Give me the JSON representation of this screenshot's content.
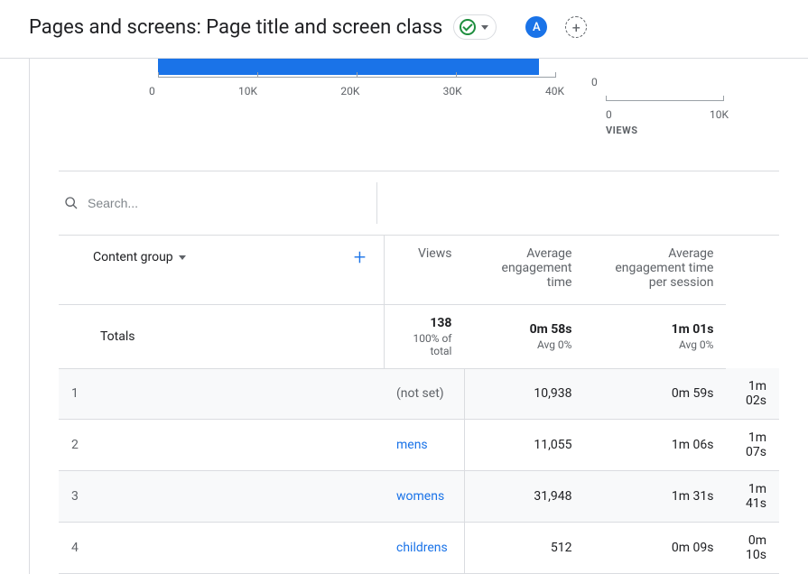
{
  "header": {
    "title": "Pages and screens: Page title and screen class",
    "avatar_letter": "A"
  },
  "chart_data": {
    "type": "bar",
    "main_axis_ticks": [
      "0",
      "10K",
      "20K",
      "30K",
      "40K"
    ],
    "side": {
      "zero_label": "0",
      "ticks": [
        "0",
        "10K"
      ],
      "label": "VIEWS"
    }
  },
  "search": {
    "placeholder": "Search..."
  },
  "table": {
    "dimension_label": "Content group",
    "columns": [
      "Views",
      "Average engagement time",
      "Average engagement time per session"
    ],
    "totals": {
      "label": "Totals",
      "cells": [
        {
          "value": "138",
          "sub": "100% of total"
        },
        {
          "value": "0m 58s",
          "sub": "Avg 0%"
        },
        {
          "value": "1m 01s",
          "sub": "Avg 0%"
        }
      ]
    },
    "rows": [
      {
        "idx": "1",
        "name": "(not set)",
        "noset": true,
        "views": "10,938",
        "aet": "0m 59s",
        "aets": "1m 02s"
      },
      {
        "idx": "2",
        "name": "mens",
        "noset": false,
        "views": "11,055",
        "aet": "1m 06s",
        "aets": "1m 07s"
      },
      {
        "idx": "3",
        "name": "womens",
        "noset": false,
        "views": "31,948",
        "aet": "1m 31s",
        "aets": "1m 41s"
      },
      {
        "idx": "4",
        "name": "childrens",
        "noset": false,
        "views": "512",
        "aet": "0m 09s",
        "aets": "0m 10s"
      }
    ]
  }
}
